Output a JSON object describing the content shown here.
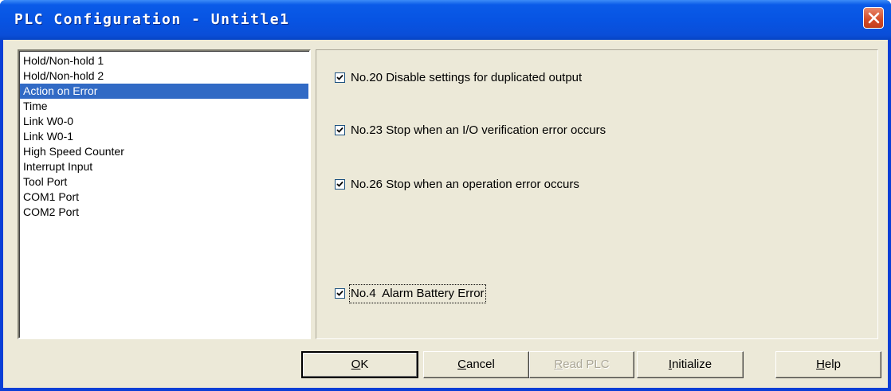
{
  "window": {
    "title": "PLC Configuration - Untitle1",
    "close_icon": "close-icon"
  },
  "sidebar": {
    "items": [
      {
        "label": "Hold/Non-hold 1",
        "selected": false
      },
      {
        "label": "Hold/Non-hold 2",
        "selected": false
      },
      {
        "label": "Action on Error",
        "selected": true
      },
      {
        "label": "Time",
        "selected": false
      },
      {
        "label": "Link W0-0",
        "selected": false
      },
      {
        "label": "Link W0-1",
        "selected": false
      },
      {
        "label": "High Speed Counter",
        "selected": false
      },
      {
        "label": "Interrupt Input",
        "selected": false
      },
      {
        "label": "Tool Port",
        "selected": false
      },
      {
        "label": "COM1 Port",
        "selected": false
      },
      {
        "label": "COM2 Port",
        "selected": false
      }
    ]
  },
  "settings": {
    "options": [
      {
        "label": "No.20 Disable settings for duplicated output",
        "checked": true
      },
      {
        "label": "No.23 Stop when an I/O verification error occurs",
        "checked": true
      },
      {
        "label": "No.26 Stop when an operation error occurs",
        "checked": true
      },
      {
        "label": "No.4  Alarm Battery Error",
        "checked": true
      }
    ]
  },
  "buttons": {
    "ok": {
      "accel": "O",
      "rest": "K"
    },
    "cancel": {
      "accel": "C",
      "rest": "ancel"
    },
    "read_plc": {
      "accel": "R",
      "rest": "ead PLC",
      "disabled": true
    },
    "initialize": {
      "accel": "I",
      "rest": "nitialize"
    },
    "help": {
      "accel": "H",
      "rest": "elp"
    }
  },
  "colors": {
    "titlebar": "#0754e3",
    "selection": "#316ac5",
    "dialog_face": "#ece9d8",
    "close_button": "#d34a26"
  }
}
